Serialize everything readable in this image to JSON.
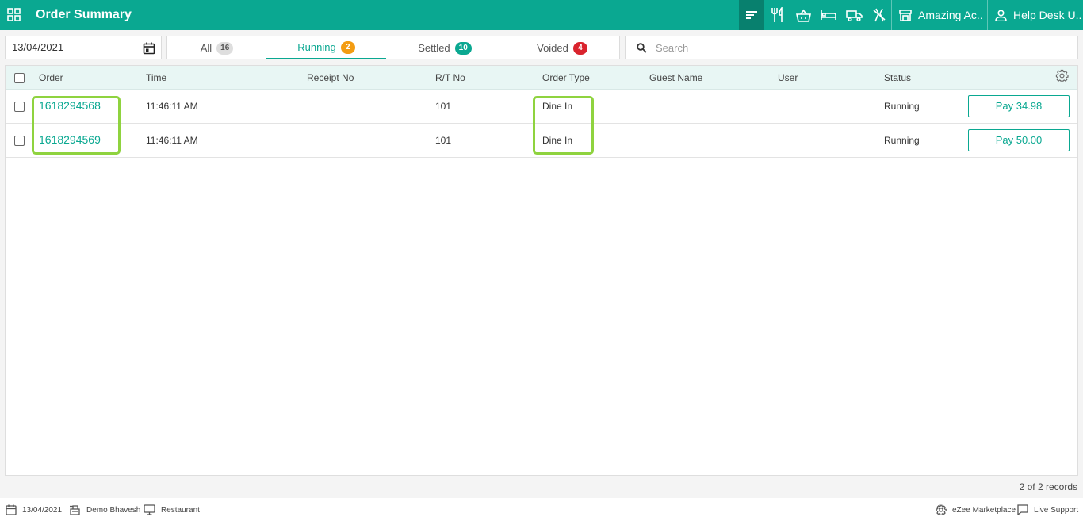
{
  "header": {
    "title": "Order Summary",
    "property_name": "Amazing Ac...",
    "user_name": "Help Desk U..."
  },
  "toolbar": {
    "date": "13/04/2021",
    "search_placeholder": "Search",
    "tabs": [
      {
        "label": "All",
        "count": "16",
        "color": "#dedede"
      },
      {
        "label": "Running",
        "count": "2",
        "color": "#f39c12"
      },
      {
        "label": "Settled",
        "count": "10",
        "color": "#0aa891"
      },
      {
        "label": "Voided",
        "count": "4",
        "color": "#d9232d"
      }
    ],
    "active_tab": "Running"
  },
  "table": {
    "columns": [
      "Order",
      "Time",
      "Receipt No",
      "R/T No",
      "Order Type",
      "Guest Name",
      "User",
      "Status"
    ],
    "rows": [
      {
        "order": "1618294568",
        "time": "11:46:11 AM",
        "receipt_no": "",
        "rt_no": "101",
        "order_type": "Dine In",
        "guest_name": "",
        "user": "",
        "status": "Running",
        "action": "Pay 34.98"
      },
      {
        "order": "1618294569",
        "time": "11:46:11 AM",
        "receipt_no": "",
        "rt_no": "101",
        "order_type": "Dine In",
        "guest_name": "",
        "user": "",
        "status": "Running",
        "action": "Pay 50.00"
      }
    ],
    "record_count": "2 of 2 records"
  },
  "footer": {
    "date": "13/04/2021",
    "user": "Demo Bhavesh",
    "terminal": "Restaurant",
    "marketplace": "eZee Marketplace",
    "support": "Live Support"
  },
  "colors": {
    "brand": "#0aa891",
    "brand_dark": "#08806e",
    "highlight": "#8fd33f"
  }
}
